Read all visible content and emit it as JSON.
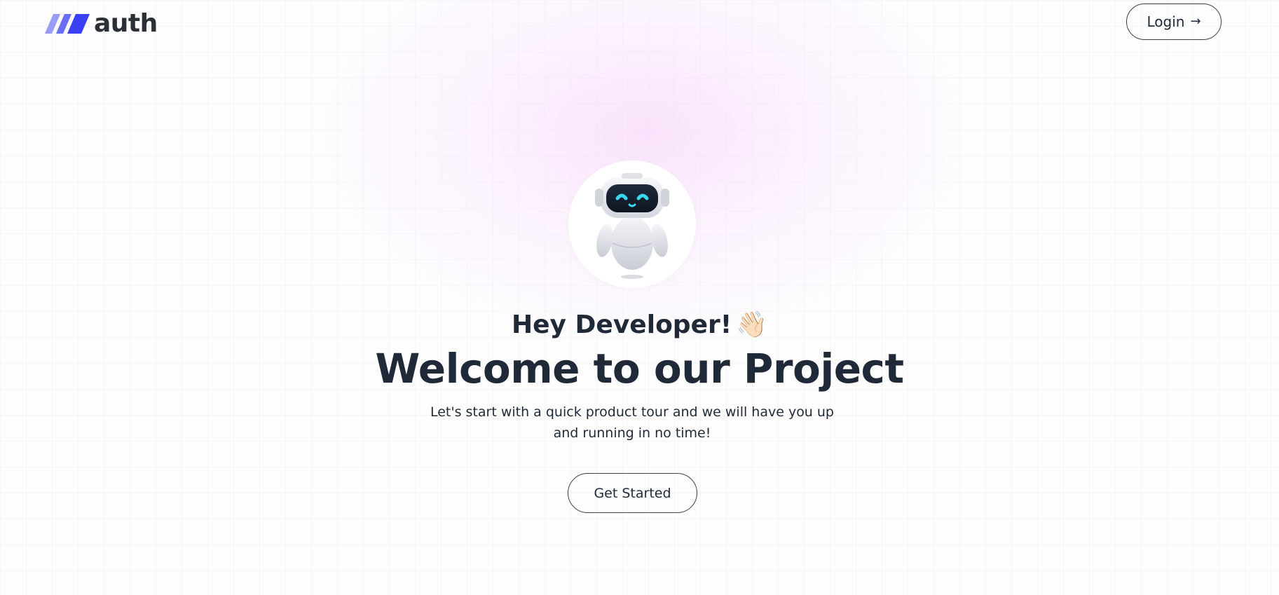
{
  "header": {
    "logo_text": "auth",
    "login_label": "Login",
    "login_icon": "arrow-right-icon"
  },
  "hero": {
    "avatar_icon": "robot-icon",
    "greeting": "Hey Developer!",
    "greeting_emoji": "👋🏻",
    "title": "Welcome to our Project",
    "subtitle": "Let's start with a quick product tour and we will have you up and running in no time!",
    "cta_label": "Get Started"
  },
  "colors": {
    "logo_blue": "#3b3ff5",
    "logo_light": "#8c8ff8",
    "text_dark": "#1f2937",
    "robot_eye": "#3ad6f0",
    "glow_pink": "#f5cdfa"
  }
}
